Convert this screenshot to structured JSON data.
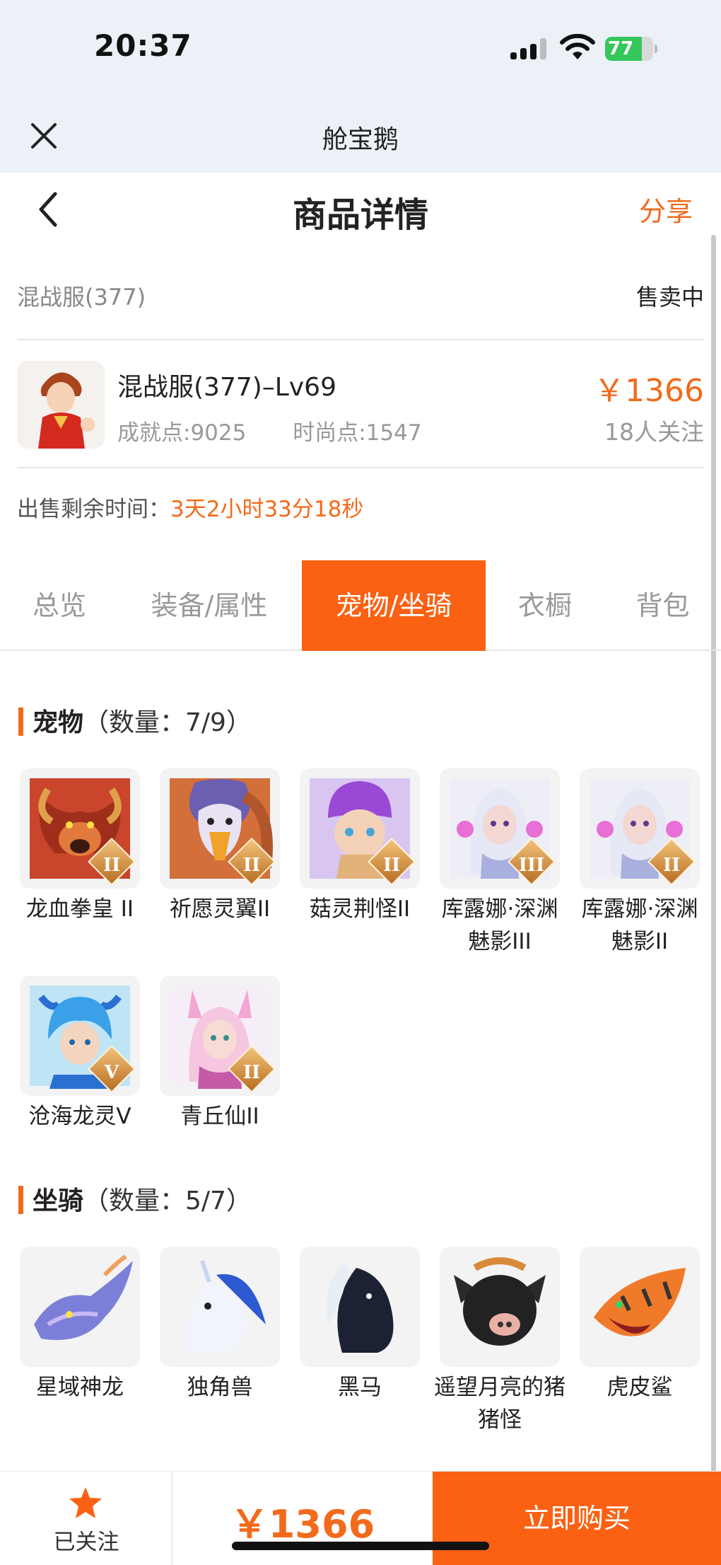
{
  "status": {
    "time": "20:37",
    "battery": "77"
  },
  "app": {
    "title": "舱宝鹅"
  },
  "nav": {
    "title": "商品详情",
    "share": "分享"
  },
  "listing": {
    "server": "混战服(377)",
    "sale_status": "售卖中",
    "name": "混战服(377)–Lv69",
    "achievement": "成就点:9025",
    "fashion": "时尚点:1547",
    "price": "￥1366",
    "followers": "18人关注",
    "remain_label": "出售剩余时间：",
    "remain_value": "3天2小时33分18秒"
  },
  "tabs": [
    "总览",
    "装备/属性",
    "宠物/坐骑",
    "衣橱",
    "背包"
  ],
  "active_tab": "宠物/坐骑",
  "pets": {
    "title": "宠物",
    "count": "（数量：7/9）",
    "items": [
      {
        "label": "龙血拳皇 II",
        "badge": "II",
        "icon": "red-dragon-fist-pet"
      },
      {
        "label": "祈愿灵翼II",
        "badge": "II",
        "icon": "griffin-bird-pet"
      },
      {
        "label": "菇灵荆怪II",
        "badge": "II",
        "icon": "purple-mushroom-pet"
      },
      {
        "label": "库露娜·深渊魅影III",
        "badge": "III",
        "icon": "white-hair-girl-pet"
      },
      {
        "label": "库露娜·深渊魅影II",
        "badge": "II",
        "icon": "white-hair-girl-pet"
      },
      {
        "label": "沧海龙灵V",
        "badge": "V",
        "icon": "blue-dragon-boy-pet"
      },
      {
        "label": "青丘仙II",
        "badge": "II",
        "icon": "fox-girl-pet"
      }
    ]
  },
  "mounts": {
    "title": "坐骑",
    "count": "（数量：5/7）",
    "items": [
      {
        "label": "星域神龙",
        "icon": "star-dragon-mount"
      },
      {
        "label": "独角兽",
        "icon": "unicorn-mount"
      },
      {
        "label": "黑马",
        "icon": "black-horse-mount"
      },
      {
        "label": "遥望月亮的猪猪怪",
        "icon": "pig-monster-mount"
      },
      {
        "label": "虎皮鲨",
        "icon": "tiger-shark-mount"
      }
    ]
  },
  "bottom": {
    "follow_label": "已关注",
    "price": "￥1366",
    "buy_label": "立即购买"
  },
  "colors": {
    "accent": "#fb6112",
    "price": "#f26a1b",
    "header_bg": "#ebf1f6"
  }
}
